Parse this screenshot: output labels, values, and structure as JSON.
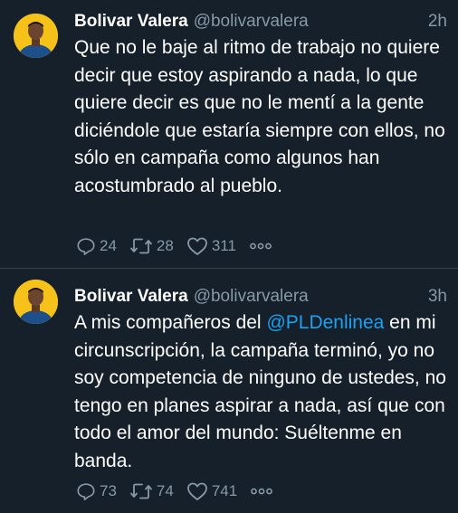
{
  "tweets": [
    {
      "author_name": "Bolivar Valera",
      "handle": "@bolivarvalera",
      "time": "2h",
      "text": "Que no le baje al ritmo de trabajo no quiere decir que estoy aspirando a nada, lo que quiere decir es que no le mentí a la gente diciéndole que estaría siempre con ellos, no sólo en campaña como algunos han acostumbrado al pueblo.",
      "replies": "24",
      "retweets": "28",
      "likes": "311"
    },
    {
      "author_name": "Bolivar Valera",
      "handle": "@bolivarvalera",
      "time": "3h",
      "text_before": "A mis compañeros del ",
      "mention": "@PLDenlinea",
      "text_after": " en mi circunscripción, la campaña terminó, yo no soy competencia de ninguno de ustedes, no tengo en planes aspirar a nada, así que con todo el amor del mundo: Suéltenme en banda.",
      "replies": "73",
      "retweets": "74",
      "likes": "741"
    }
  ],
  "icons": {
    "reply": "reply-icon",
    "retweet": "retweet-icon",
    "like": "heart-icon",
    "more": "more-icon"
  },
  "colors": {
    "background": "#15202b",
    "secondary_text": "#8899a6",
    "link": "#1da1f2",
    "divider": "#38444d",
    "avatar_bg": "#f6c21a"
  }
}
